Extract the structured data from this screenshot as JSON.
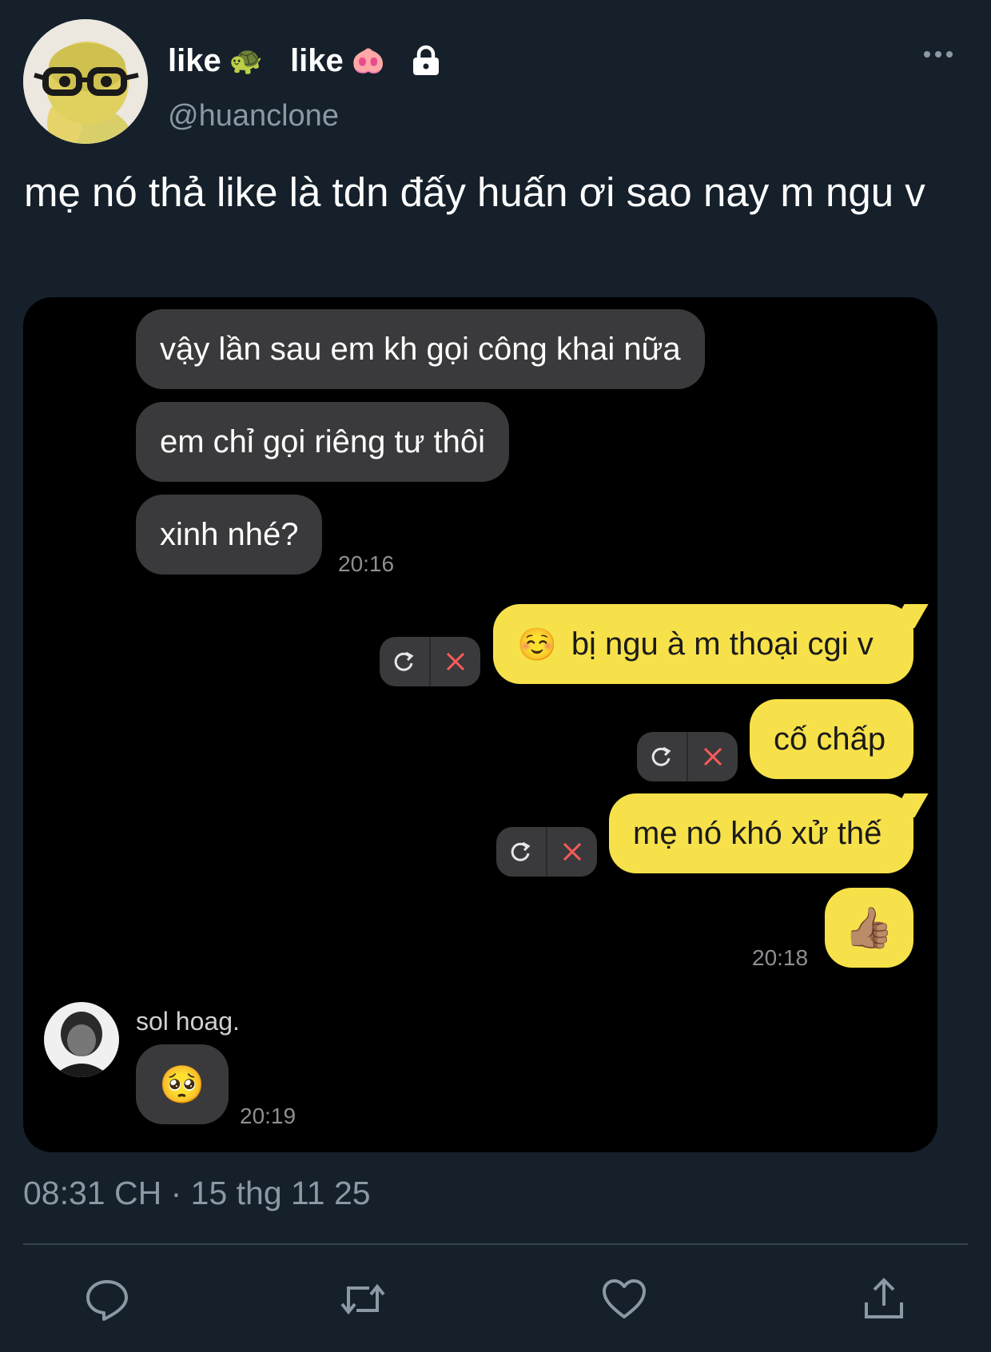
{
  "author": {
    "name_parts": [
      "like",
      "like"
    ],
    "name_emojis": [
      "🐢",
      "🐽"
    ],
    "handle": "@huanclone",
    "more_icon": "more-horizontal-icon",
    "protected_icon": "lock-icon"
  },
  "tweet": {
    "text": "mẹ nó thả like là tdn đấy huấn ơi sao nay m ngu v",
    "timestamp": "08:31 CH · 15 thg 11 25"
  },
  "chat": {
    "incoming": [
      "vậy lần sau em kh gọi công khai nữa",
      "em chỉ gọi riêng tư thôi",
      "xinh nhé?"
    ],
    "incoming_time": "20:16",
    "outgoing": [
      {
        "emoji": "☺️",
        "text": "bị ngu à m thoại cgi v"
      },
      {
        "emoji": "",
        "text": "cố chấp"
      },
      {
        "emoji": "",
        "text": "mẹ nó khó xử thế"
      },
      {
        "emoji": "👍🏽",
        "text": ""
      }
    ],
    "outgoing_time": "20:18",
    "reply": {
      "sender": "sol hoag.",
      "emoji": "🥺",
      "time": "20:19"
    }
  },
  "actions": [
    "reply-icon",
    "retweet-icon",
    "like-icon",
    "share-icon"
  ]
}
